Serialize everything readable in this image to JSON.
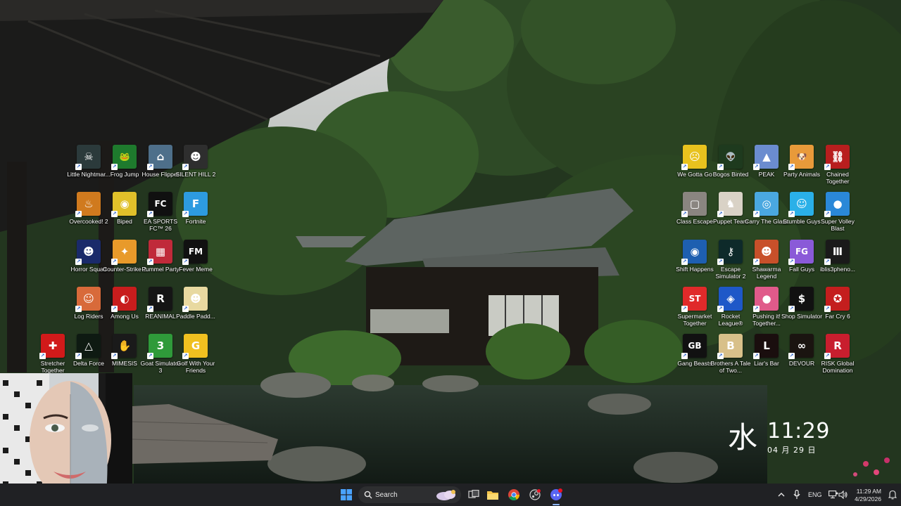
{
  "desktop": {
    "left_icons": [
      {
        "label": "Little Nightmar...",
        "icon": "little-nightmares-icon",
        "color": "#2b3a3b",
        "glyph": "☠"
      },
      {
        "label": "Frog Jump",
        "icon": "frog-jump-icon",
        "color": "#1e7a2d",
        "glyph": "🐸"
      },
      {
        "label": "House Flipper",
        "icon": "house-flipper-icon",
        "color": "#4e6f8a",
        "glyph": "⌂"
      },
      {
        "label": "SILENT HILL 2",
        "icon": "silent-hill-icon",
        "color": "#2e2e2e",
        "glyph": "☻"
      },
      {
        "label": "Overcooked! 2",
        "icon": "overcooked-icon",
        "color": "#d07a1e",
        "glyph": "♨"
      },
      {
        "label": "Biped",
        "icon": "biped-icon",
        "color": "#e0c12a",
        "glyph": "◉"
      },
      {
        "label": "EA SPORTS FC™ 26",
        "icon": "ea-sports-fc-icon",
        "color": "#101010",
        "glyph": "FC"
      },
      {
        "label": "Fortnite",
        "icon": "fortnite-icon",
        "color": "#2d9be0",
        "glyph": "F"
      },
      {
        "label": "Horror Squad",
        "icon": "horror-squad-icon",
        "color": "#1a2a6a",
        "glyph": "☻"
      },
      {
        "label": "Counter-Strike 2",
        "icon": "counter-strike-icon",
        "color": "#e89a2a",
        "glyph": "✦"
      },
      {
        "label": "Pummel Party",
        "icon": "pummel-party-icon",
        "color": "#c02a3a",
        "glyph": "▦"
      },
      {
        "label": "Fever Meme",
        "icon": "fever-meme-icon",
        "color": "#111111",
        "glyph": "FM"
      },
      {
        "label": "Log Riders",
        "icon": "log-riders-icon",
        "color": "#d86a3a",
        "glyph": "☺"
      },
      {
        "label": "Among Us",
        "icon": "among-us-icon",
        "color": "#c81d1d",
        "glyph": "◐"
      },
      {
        "label": "REANIMAL",
        "icon": "reanimal-icon",
        "color": "#151515",
        "glyph": "R"
      },
      {
        "label": "Paddle Padd...",
        "icon": "paddle-paddle-icon",
        "color": "#e8d9a0",
        "glyph": "☻"
      },
      {
        "label": "Stretcher Together",
        "icon": "stretcher-together-icon",
        "color": "#d11a1a",
        "glyph": "✚"
      },
      {
        "label": "Delta Force",
        "icon": "delta-force-icon",
        "color": "#0e1a12",
        "glyph": "△"
      },
      {
        "label": "MIMESIS",
        "icon": "mimesis-icon",
        "color": "#1a1a1a",
        "glyph": "✋"
      },
      {
        "label": "Goat Simulator 3",
        "icon": "goat-simulator-icon",
        "color": "#2f9a3a",
        "glyph": "3"
      },
      {
        "label": "Golf With Your Friends",
        "icon": "golf-with-friends-icon",
        "color": "#f0c020",
        "glyph": "G"
      }
    ],
    "right_icons": [
      {
        "label": "We Gotta Go",
        "icon": "we-gotta-go-icon",
        "color": "#e8c21e",
        "glyph": "☹"
      },
      {
        "label": "Bogos Binted",
        "icon": "bogos-binted-icon",
        "color": "#1e3a1e",
        "glyph": "👽"
      },
      {
        "label": "PEAK",
        "icon": "peak-icon",
        "color": "#6b8ccf",
        "glyph": "▲"
      },
      {
        "label": "Party Animals",
        "icon": "party-animals-icon",
        "color": "#e89a3a",
        "glyph": "🐶"
      },
      {
        "label": "Chained Together",
        "icon": "chained-together-icon",
        "color": "#b81e1e",
        "glyph": "⛓"
      },
      {
        "label": "Class Escape",
        "icon": "class-escape-icon",
        "color": "#8a8580",
        "glyph": "▢"
      },
      {
        "label": "Puppet Team",
        "icon": "puppet-team-icon",
        "color": "#d9d2c6",
        "glyph": "♞"
      },
      {
        "label": "Carry The Glass",
        "icon": "carry-the-glass-icon",
        "color": "#4aa8e0",
        "glyph": "◎"
      },
      {
        "label": "Stumble Guys",
        "icon": "stumble-guys-icon",
        "color": "#2ab0e8",
        "glyph": "☺"
      },
      {
        "label": "Super Volley Blast",
        "icon": "super-volley-blast-icon",
        "color": "#2a88d8",
        "glyph": "●"
      },
      {
        "label": "Shift Happens",
        "icon": "shift-happens-icon",
        "color": "#1e5fb0",
        "glyph": "◉"
      },
      {
        "label": "Escape Simulator 2",
        "icon": "escape-simulator-icon",
        "color": "#0e2a2a",
        "glyph": "⚷"
      },
      {
        "label": "Shawarma Legend",
        "icon": "shawarma-legend-icon",
        "color": "#c8502a",
        "glyph": "☻"
      },
      {
        "label": "Fall Guys",
        "icon": "fall-guys-icon",
        "color": "#8a5ad8",
        "glyph": "FG"
      },
      {
        "label": "iblis3pheno...",
        "icon": "iblis-icon",
        "color": "#1a1a1a",
        "glyph": "Ⅲ"
      },
      {
        "label": "Supermarket Together",
        "icon": "supermarket-together-icon",
        "color": "#e02a2a",
        "glyph": "ST"
      },
      {
        "label": "Rocket League®",
        "icon": "rocket-league-icon",
        "color": "#1e58c8",
        "glyph": "◈"
      },
      {
        "label": "Pushing it! Together...",
        "icon": "pushing-it-together-icon",
        "color": "#e05a8a",
        "glyph": "●"
      },
      {
        "label": "Shop Simulator",
        "icon": "shop-simulator-icon",
        "color": "#111111",
        "glyph": "$"
      },
      {
        "label": "Far Cry 6",
        "icon": "far-cry-icon",
        "color": "#c41e1e",
        "glyph": "✪"
      },
      {
        "label": "Gang Beasts",
        "icon": "gang-beasts-icon",
        "color": "#111111",
        "glyph": "GB"
      },
      {
        "label": "Brothers A Tale of Two...",
        "icon": "brothers-icon",
        "color": "#d8c08a",
        "glyph": "B"
      },
      {
        "label": "Liar's Bar",
        "icon": "liars-bar-icon",
        "color": "#1a0e0e",
        "glyph": "L"
      },
      {
        "label": "DEVOUR",
        "icon": "devour-icon",
        "color": "#1a1410",
        "glyph": "∞"
      },
      {
        "label": "RISK Global Domination",
        "icon": "risk-icon",
        "color": "#c81e2e",
        "glyph": "R"
      }
    ]
  },
  "clock_widget": {
    "kanji": "水",
    "time": "11:29",
    "date": "04 月 29 日"
  },
  "taskbar": {
    "search_label": "Search",
    "apps": [
      {
        "name": "start-button",
        "icon": "windows-logo-icon"
      },
      {
        "name": "task-view-button",
        "icon": "task-view-icon"
      },
      {
        "name": "file-explorer-button",
        "icon": "folder-icon"
      },
      {
        "name": "chrome-button",
        "icon": "chrome-icon"
      },
      {
        "name": "steam-button",
        "icon": "steam-icon"
      },
      {
        "name": "discord-button",
        "icon": "discord-icon"
      }
    ],
    "tray": {
      "language": "ENG",
      "time": "11:29 AM",
      "date": "4/29/2026"
    },
    "colors": {
      "background": "#202124",
      "accent": "#4aa3ff",
      "discord": "#5865f2"
    }
  }
}
